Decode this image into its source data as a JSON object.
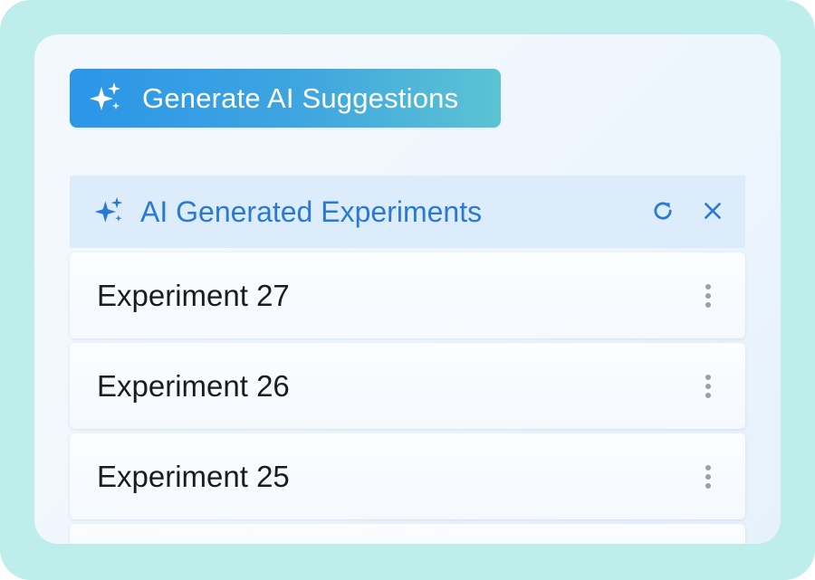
{
  "generate_button": {
    "label": "Generate AI Suggestions",
    "icon": "sparkles-icon"
  },
  "panel": {
    "title": "AI Generated Experiments",
    "icon": "sparkles-icon",
    "actions": {
      "refresh": "refresh-icon",
      "close": "close-icon"
    },
    "items": [
      {
        "label": "Experiment 27"
      },
      {
        "label": "Experiment 26"
      },
      {
        "label": "Experiment 25"
      },
      {
        "label": ""
      }
    ]
  },
  "colors": {
    "outer_bg": "#bdeeeb",
    "accent": "#2a7ad4",
    "header_bg": "#dcecfa",
    "button_gradient_start": "#2b95e8",
    "button_gradient_end": "#5cc3d3",
    "kebab": "#9aa0a6"
  }
}
